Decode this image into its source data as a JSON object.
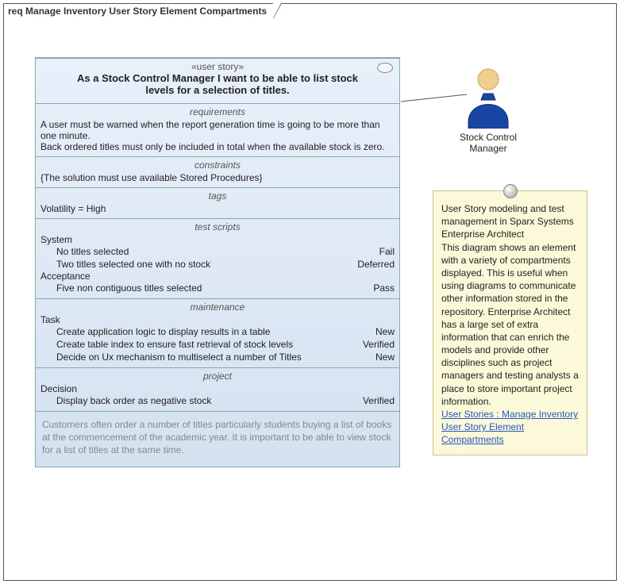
{
  "frame": {
    "prefix": "req",
    "title": "Manage Inventory User Story Element Compartments"
  },
  "element": {
    "stereotype": "«user story»",
    "title": "As a Stock Control Manager I want to be able to list stock levels for a selection of titles.",
    "requirements": {
      "header": "requirements",
      "items": [
        "A user must be warned when the report generation time is going to be more than one minute.",
        "Back ordered titles must only be included in total when the available stock is zero."
      ]
    },
    "constraints": {
      "header": "constraints",
      "text": "{The solution must use available Stored Procedures}"
    },
    "tags": {
      "header": "tags",
      "text": "Volatility = High"
    },
    "test_scripts": {
      "header": "test scripts",
      "groups": [
        {
          "name": "System",
          "rows": [
            {
              "label": "No titles selected",
              "status": "Fail"
            },
            {
              "label": "Two titles selected one with no stock",
              "status": "Deferred"
            }
          ]
        },
        {
          "name": "Acceptance",
          "rows": [
            {
              "label": "Five non contiguous titles selected",
              "status": "Pass"
            }
          ]
        }
      ]
    },
    "maintenance": {
      "header": "maintenance",
      "groups": [
        {
          "name": "Task",
          "rows": [
            {
              "label": "Create application logic to display results in a table",
              "status": "New"
            },
            {
              "label": "Create table index to ensure fast retrieval of stock levels",
              "status": "Verified"
            },
            {
              "label": "Decide on Ux mechanism to multiselect a number of Titles",
              "status": "New"
            }
          ]
        }
      ]
    },
    "project": {
      "header": "project",
      "groups": [
        {
          "name": "Decision",
          "rows": [
            {
              "label": "Display back order as negative stock",
              "status": "Verified"
            }
          ]
        }
      ]
    },
    "notes": "Customers often order a number of titles particularly students buying a list of books at the commencement of the academic year. It is important to be able to view stock for a list of titles at the same time."
  },
  "actor": {
    "label": "Stock Control Manager"
  },
  "note": {
    "body": "User Story modeling and test management in Sparx Systems Enterprise Architect\nThis diagram shows an element with a variety of compartments displayed. This is useful when using diagrams to communicate other information stored in the repository. Enterprise Architect has a large set of extra information that can enrich the models and provide other disciplines such as project managers and testing analysts a place to store important project information.",
    "link": "User Stories : Manage Inventory User Story Element Compartments"
  }
}
